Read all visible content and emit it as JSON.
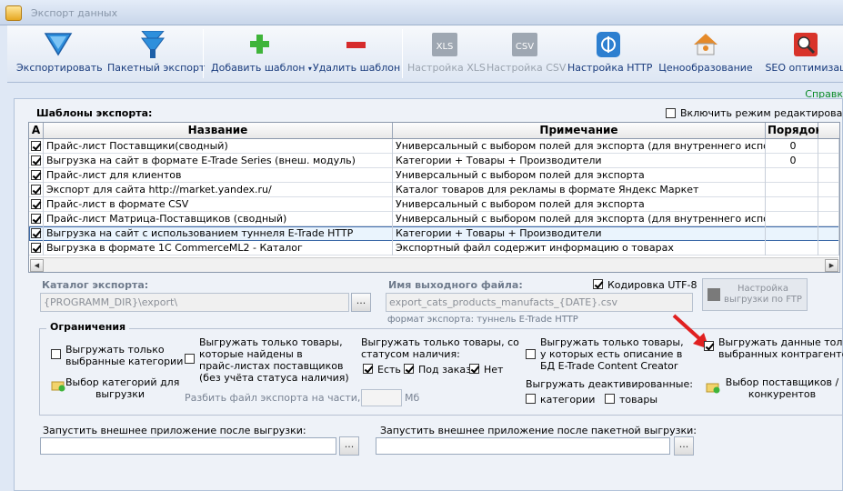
{
  "window": {
    "title": "Экспорт данных"
  },
  "toolbar": {
    "export": "Экспортировать",
    "batch_export": "Пакетный экспорт",
    "add_template": "Добавить шаблон",
    "add_template_arrow": "▾",
    "delete_template": "Удалить шаблон",
    "xls_settings": "Настройка XLS",
    "xls_badge": "XLS",
    "csv_settings": "Настройка CSV",
    "csv_badge": "CSV",
    "http_settings": "Настройка HTTP",
    "pricing": "Ценообразование",
    "seo": "SEO оптимизац"
  },
  "help_link": "Справк",
  "templates": {
    "title": "Шаблоны экспорта:",
    "edit_mode_label": "Включить режим редактирования",
    "edit_mode_checked": false,
    "columns": {
      "active": "А",
      "name": "Название",
      "note": "Примечание",
      "order": "Порядок"
    },
    "rows": [
      {
        "checked": true,
        "name": "Прайс-лист Поставщики(сводный)",
        "note": "Универсальный с выбором полей для экспорта (для внутреннего использования)",
        "order": "0"
      },
      {
        "checked": true,
        "name": "Выгрузка на сайт в формате E-Trade Series (внеш. модуль)",
        "note": "Категории + Товары + Производители",
        "order": "0"
      },
      {
        "checked": true,
        "name": "Прайс-лист для клиентов",
        "note": "Универсальный с выбором полей для экспорта",
        "order": ""
      },
      {
        "checked": true,
        "name": "Экспорт для сайта http://market.yandex.ru/",
        "note": "Каталог товаров для рекламы в формате Яндекс Маркет",
        "order": ""
      },
      {
        "checked": true,
        "name": "Прайс-лист в формате CSV",
        "note": "Универсальный с выбором полей для экспорта",
        "order": ""
      },
      {
        "checked": true,
        "name": "Прайс-лист Матрица-Поставщиков (сводный)",
        "note": "Универсальный с выбором полей для экспорта (для внутреннего использования)",
        "order": ""
      },
      {
        "checked": true,
        "name": "Выгрузка на сайт с использованием туннеля E-Trade HTTP",
        "note": "Категории + Товары + Производители",
        "order": "",
        "selected": true
      },
      {
        "checked": true,
        "name": "Выгрузка в формате 1C CommerceML2 - Каталог",
        "note": "Экспортный файл содержит информацию о товарах",
        "order": ""
      }
    ]
  },
  "catalog": {
    "label": "Каталог экспорта:",
    "value": "{PROGRAMM_DIR}\\export\\",
    "browse": "..."
  },
  "output_file": {
    "label": "Имя выходного файла:",
    "value": "export_cats_products_manufacts_{DATE}.csv",
    "format_note": "формат экспорта: туннель E-Trade HTTP"
  },
  "utf8": {
    "label": "Кодировка UTF-8",
    "checked": true
  },
  "ftp_button": {
    "line1": "Настройка",
    "line2": "выгрузки по FTP"
  },
  "limits": {
    "title": "Ограничения",
    "selected_categories": {
      "line1": "Выгружать только",
      "line2": "выбранные категории",
      "checked": false
    },
    "choose_categories": {
      "line1": "Выбор категорий для",
      "line2": "выгрузки"
    },
    "supplier_found": {
      "line1": "Выгружать только товары,",
      "line2": "которые найдены в",
      "line3": "прайс-листах поставщиков",
      "line4": "(без учёта статуса наличия)",
      "checked": false
    },
    "split": {
      "label": "Разбить файл экспорта на части, по:",
      "value": "",
      "unit": "Мб"
    },
    "status": {
      "line1": "Выгружать только товары, со",
      "line2": "статусом наличия:",
      "yes": "Есть",
      "order": "Под заказ",
      "no": "Нет",
      "yes_checked": true,
      "order_checked": true,
      "no_checked": true
    },
    "etrade_desc": {
      "line1": "Выгружать только товары,",
      "line2": "у которых есть описание в",
      "line3": "БД E-Trade Content Creator",
      "checked": false
    },
    "deactivated": {
      "label": "Выгружать деактивированные:",
      "categories": "категории",
      "products": "товары",
      "categories_checked": false,
      "products_checked": false
    },
    "selected_suppliers": {
      "line1": "Выгружать данные только",
      "line2": "выбранных контрагентов",
      "checked": true
    },
    "choose_suppliers": {
      "line1": "Выбор поставщиков /",
      "line2": "конкурентов"
    }
  },
  "after_export": {
    "label": "Запустить внешнее приложение после выгрузки:",
    "value": "",
    "browse": "..."
  },
  "after_batch": {
    "label": "Запустить внешнее приложение после пакетной выгрузки:",
    "value": "",
    "browse": "..."
  },
  "colors": {
    "accent": "#1a3c7d",
    "arrow": "#e02020",
    "help": "#0a8a26",
    "selection": "#eaf4fd"
  }
}
